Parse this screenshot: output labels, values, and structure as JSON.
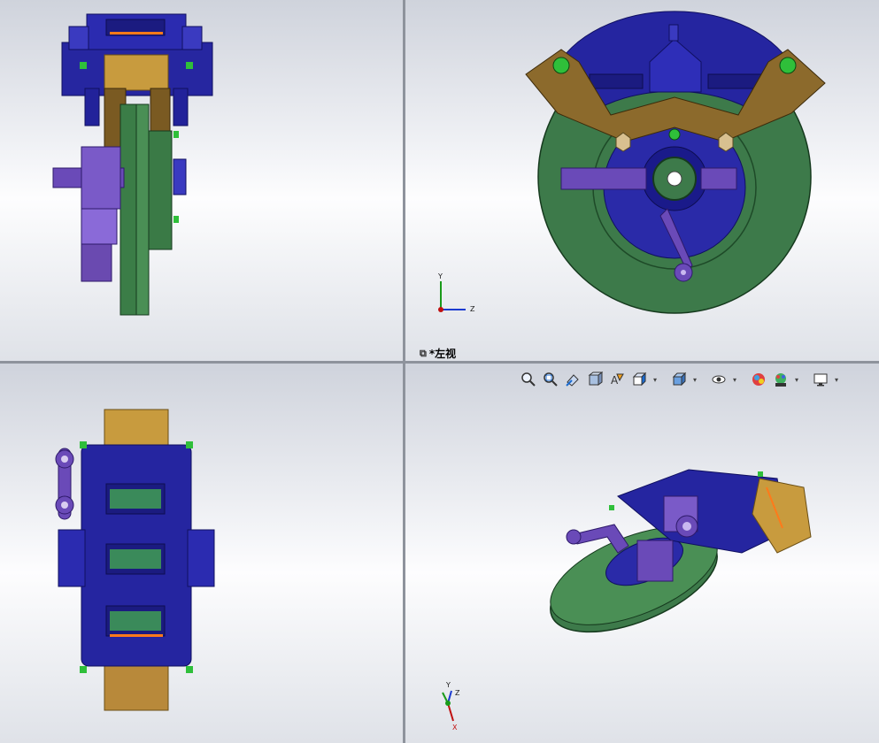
{
  "active_view": {
    "name": "*左视",
    "link_icon": "link-icon"
  },
  "triad_labels": {
    "top_right": {
      "y": "Y",
      "z": "Z"
    },
    "bottom_right": {
      "z": "Z",
      "y": "Y",
      "x": "X"
    }
  },
  "heads_up_toolbar": [
    {
      "name": "zoom-to-fit-icon"
    },
    {
      "name": "zoom-to-area-icon"
    },
    {
      "name": "previous-view-icon"
    },
    {
      "name": "section-view-icon"
    },
    {
      "name": "dynamic-annotation-icon"
    },
    {
      "name": "view-orientation-icon",
      "dropdown": true
    },
    {
      "name": "display-style-icon",
      "dropdown": true
    },
    {
      "name": "hide-show-items-icon",
      "dropdown": true
    },
    {
      "name": "edit-appearance-icon"
    },
    {
      "name": "apply-scene-icon",
      "dropdown": true
    },
    {
      "name": "view-settings-icon",
      "dropdown": true
    }
  ],
  "colors": {
    "blue_body": "#2a2aa8",
    "green_disc": "#3d7a4a",
    "gold_plate": "#c79a3c",
    "bronze_arm": "#8a6a2a",
    "purple_lever": "#6a4ab8",
    "orange_accent": "#ff7a1a",
    "bolt_green": "#2fbf3a"
  }
}
